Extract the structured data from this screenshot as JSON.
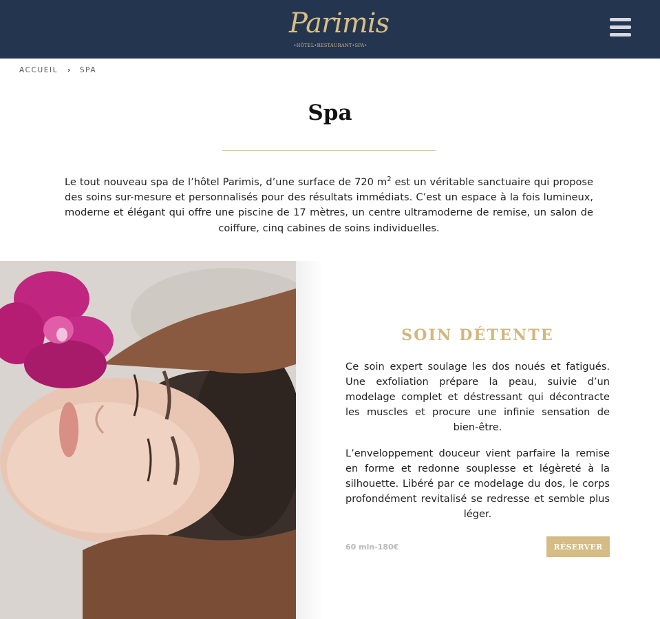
{
  "header": {
    "logo_text": "Parimis",
    "logo_subtitle": "•HÔTEL•RESTAURANT•SPA•",
    "menu_icon": "hamburger-menu-icon",
    "background_color": "#243550",
    "accent_color": "#d8be85"
  },
  "breadcrumb": {
    "home": "ACCUEIL",
    "separator_icon": "chevron-right-icon",
    "current": "SPA"
  },
  "page": {
    "title": "Spa",
    "intro_before_sup": "Le tout nouveau spa de l’hôtel Parimis, d’une surface de 720 m",
    "intro_sup": "2",
    "intro_after_sup": " est un véritable sanctuaire qui propose des soins sur-mesure et personnalisés pour des résultats immédiats. C’est un espace à la fois lumineux, moderne et élégant qui offre une piscine de 17 mètres, un centre ultramoderne de remise, un salon de coiffure, cinq cabines de soins individuelles."
  },
  "treatment": {
    "title": "SOIN DÉTENTE",
    "paragraph_1": "Ce soin expert soulage les dos noués et fatigués. Une exfoliation prépare la peau, suivie d’un modelage complet et déstressant qui décontracte les muscles et procure une infinie sensation de bien-être.",
    "paragraph_2": "L’enveloppement douceur vient parfaire la remise en forme et redonne souplesse et légèreté à la silhouette. Libéré par ce modelage du dos, le corps profondément revitalisé se redresse et semble plus léger.",
    "price": "60 min-180€",
    "button_label": "RÉSERVER",
    "button_color": "#d4bc84",
    "title_color": "#d1b77e"
  }
}
